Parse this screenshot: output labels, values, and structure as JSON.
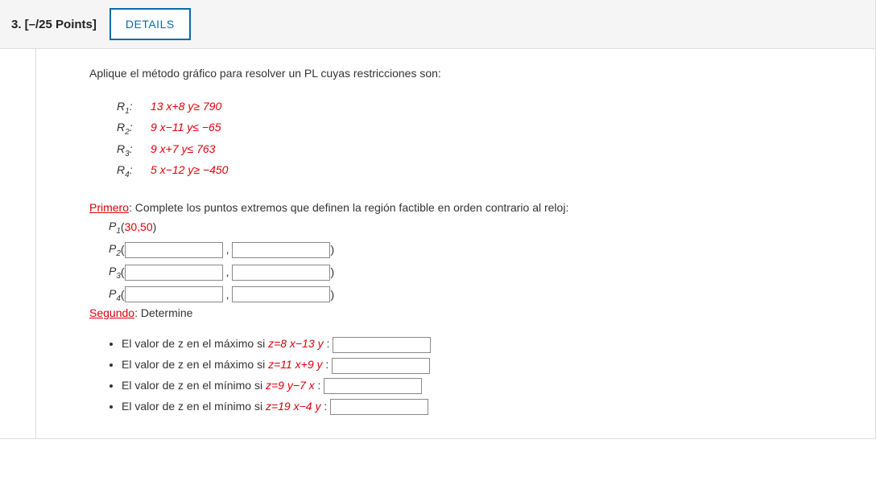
{
  "header": {
    "points_label": "3.  [–/25 Points]",
    "details_label": "DETAILS"
  },
  "intro": "Aplique el método gráfico para resolver un PL cuyas restricciones son:",
  "constraints": [
    {
      "label_prefix": "R",
      "label_sub": "1",
      "label_suffix": ":",
      "expr": "13 x+8 y≥ 790"
    },
    {
      "label_prefix": "R",
      "label_sub": "2",
      "label_suffix": ":",
      "expr": "9 x−11 y≤ −65"
    },
    {
      "label_prefix": "R",
      "label_sub": "3",
      "label_suffix": ":",
      "expr": "9 x+7 y≤ 763"
    },
    {
      "label_prefix": "R",
      "label_sub": "4",
      "label_suffix": ":",
      "expr": "5 x−12 y≥ −450"
    }
  ],
  "primero": {
    "label": "Primero",
    "text": ": Complete los puntos extremos que definen la región factible en orden contrario al reloj:",
    "p1": {
      "label_prefix": "P",
      "label_sub": "1",
      "open": "(",
      "coord": "30,50",
      "close": ")"
    },
    "points_input": [
      {
        "label_prefix": "P",
        "label_sub": "2"
      },
      {
        "label_prefix": "P",
        "label_sub": "3"
      },
      {
        "label_prefix": "P",
        "label_sub": "4"
      }
    ],
    "open_paren": "(",
    "comma": ",",
    "close_paren": ")"
  },
  "segundo": {
    "label": "Segundo",
    "text": ": Determine",
    "items": [
      {
        "lead": "El valor de z en el máximo si  ",
        "expr": "z=8 x−13 y",
        "tail": " :"
      },
      {
        "lead": "El valor de z en el máximo si  ",
        "expr": "z=11 x+9 y",
        "tail": " :"
      },
      {
        "lead": "El valor de z en el mínimo si  ",
        "expr": "z=9 y−7 x",
        "tail": " :"
      },
      {
        "lead": "El valor de z en el mínimo si  ",
        "expr": "z=19 x−4 y",
        "tail": " :"
      }
    ]
  }
}
